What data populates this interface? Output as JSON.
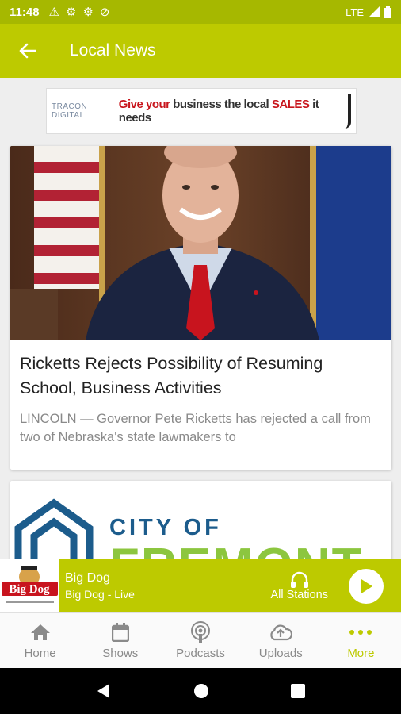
{
  "status": {
    "time": "11:48",
    "network": "LTE"
  },
  "appbar": {
    "title": "Local News"
  },
  "ad": {
    "brand": "TRACON DIGITAL",
    "slogan_a": "Give your",
    "slogan_b": "business the local",
    "slogan_c": "SALES",
    "slogan_d": "it needs"
  },
  "articles": [
    {
      "headline": "Ricketts Rejects Possibility of Resuming School, Business Activities",
      "excerpt": "LINCOLN — Governor Pete Ricketts has rejected a call from two of Nebraska's state lawmakers to"
    },
    {
      "logo_line1": "CITY OF",
      "logo_line2": "FREMONT"
    }
  ],
  "player": {
    "logo_text": "Big Dog",
    "station": "Big Dog",
    "subtitle": "Big Dog - Live",
    "all_label": "All Stations"
  },
  "tabs": [
    {
      "label": "Home",
      "icon": "home-icon"
    },
    {
      "label": "Shows",
      "icon": "calendar-icon"
    },
    {
      "label": "Podcasts",
      "icon": "podcast-icon"
    },
    {
      "label": "Uploads",
      "icon": "cloud-upload-icon"
    },
    {
      "label": "More",
      "icon": "more-dots-icon"
    }
  ],
  "colors": {
    "accent": "#bdca00",
    "statusbar": "#a6b800"
  }
}
